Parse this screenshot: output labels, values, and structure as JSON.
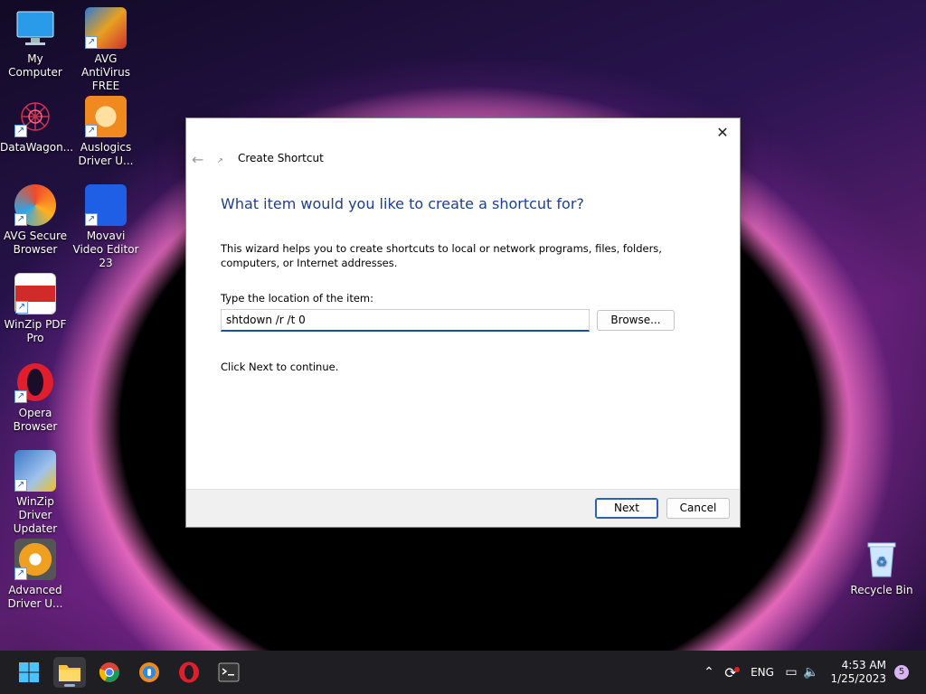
{
  "desktop": {
    "icons": [
      {
        "label": "My Computer",
        "color": "#3aa0e6"
      },
      {
        "label": "AVG AntiVirus FREE",
        "color": "#e8a020"
      },
      {
        "label": "DataWagon...",
        "color": "#c03050"
      },
      {
        "label": "Auslogics Driver U...",
        "color": "#f08a20"
      },
      {
        "label": "AVG Secure Browser",
        "color": "#e85020"
      },
      {
        "label": "Movavi Video Editor 23",
        "color": "#1f5fe6"
      },
      {
        "label": "WinZip PDF Pro",
        "color": "#d02a2a"
      },
      {
        "label": "Opera Browser",
        "color": "#e01e2e"
      },
      {
        "label": "WinZip Driver Updater",
        "color": "#3c78c8"
      },
      {
        "label": "Advanced Driver U...",
        "color": "#f0a020"
      },
      {
        "label": "Recycle Bin",
        "color": "#9fd0ff"
      }
    ]
  },
  "dialog": {
    "close_glyph": "✕",
    "back_glyph": "←",
    "title": "Create Shortcut",
    "heading": "What item would you like to create a shortcut for?",
    "description": "This wizard helps you to create shortcuts to local or network programs, files, folders, computers, or Internet addresses.",
    "location_label": "Type the location of the item:",
    "location_value": "shtdown /r /t 0",
    "browse_label": "Browse...",
    "continue_text": "Click Next to continue.",
    "next_label": "Next",
    "cancel_label": "Cancel"
  },
  "taskbar": {
    "apps": [
      "start",
      "file-explorer",
      "chrome",
      "avg-secure-browser",
      "opera",
      "terminal"
    ],
    "language": "ENG",
    "time": "4:53 AM",
    "date": "1/25/2023",
    "notification_count": "5"
  }
}
